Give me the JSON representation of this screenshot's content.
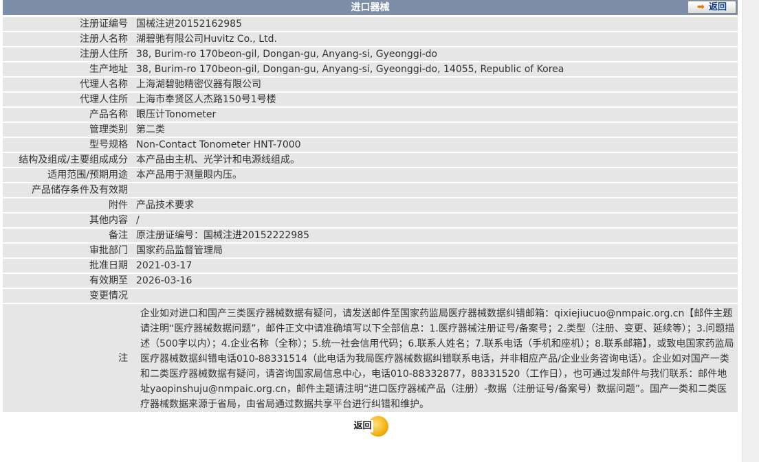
{
  "header": {
    "title": "进口器械",
    "back_label": "返回"
  },
  "rows": [
    {
      "label": "注册证编号",
      "value": "国械注进20152162985"
    },
    {
      "label": "注册人名称",
      "value": "湖碧驰有限公司Huvitz Co., Ltd."
    },
    {
      "label": "注册人住所",
      "value": "38, Burim-ro 170beon-gil, Dongan-gu, Anyang-si, Gyeonggi-do"
    },
    {
      "label": "生产地址",
      "value": "38, Burim-ro 170beon-gil, Dongan-gu, Anyang-si, Gyeonggi-do, 14055, Republic of Korea"
    },
    {
      "label": "代理人名称",
      "value": "上海湖碧驰精密仪器有限公司"
    },
    {
      "label": "代理人住所",
      "value": "上海市奉贤区人杰路150号1号楼"
    },
    {
      "label": "产品名称",
      "value": "眼压计Tonometer"
    },
    {
      "label": "管理类别",
      "value": "第二类"
    },
    {
      "label": "型号规格",
      "value": "Non-Contact Tonometer HNT-7000"
    },
    {
      "label": "结构及组成/主要组成成分",
      "value": "本产品由主机、光学计和电源线组成。"
    },
    {
      "label": "适用范围/预期用途",
      "value": "本产品用于测量眼内压。"
    },
    {
      "label": "产品储存条件及有效期",
      "value": ""
    },
    {
      "label": "附件",
      "value": "产品技术要求"
    },
    {
      "label": "其他内容",
      "value": "/"
    },
    {
      "label": "备注",
      "value": "原注册证编号：国械注进20152222985"
    },
    {
      "label": "审批部门",
      "value": "国家药品监督管理局"
    },
    {
      "label": "批准日期",
      "value": "2021-03-17"
    },
    {
      "label": "有效期至",
      "value": "2026-03-16"
    }
  ],
  "change": {
    "label": "变更情况",
    "value": ""
  },
  "note": {
    "label": "注",
    "text": "企业如对进口和国产三类医疗器械数据有疑问，请发送邮件至国家药监局医疗器械数据纠错邮箱：qixiejiucuo@nmpaic.org.cn【邮件主题请注明“医疗器械数据问题”，邮件正文中请准确填写以下全部信息：1.医疗器械注册证号/备案号；2.类型（注册、变更、延续等）；3.问题描述（500字以内）；4.企业名称（全称）；5.统一社会信用代码；6.联系人姓名；7.联系电话（手机和座机）；8.联系邮箱】，或致电国家药监局医疗器械数据纠错电话010-88331514（此电话为我局医疗器械数据纠错联系电话，并非相应产品/企业业务咨询电话）。企业如对国产一类和二类医疗器械数据有疑问，请咨询国家局信息中心，电话010-88332877，88331520（工作日），也可通过发邮件与我们联系：邮件地址yaopinshuju@nmpaic.org.cn，邮件主题请注明“进口医疗器械产品（注册）-数据（注册证号/备案号）数据问题”。国产一类和二类医疗器械数据来源于省局，由省局通过数据共享平台进行纠错和维护。"
  },
  "footer": {
    "back_label": "返回"
  },
  "colors": {
    "header_bg": "#7d8fa8",
    "row_bg": "#e6e6e6",
    "accent_orange": "#f0a800"
  }
}
